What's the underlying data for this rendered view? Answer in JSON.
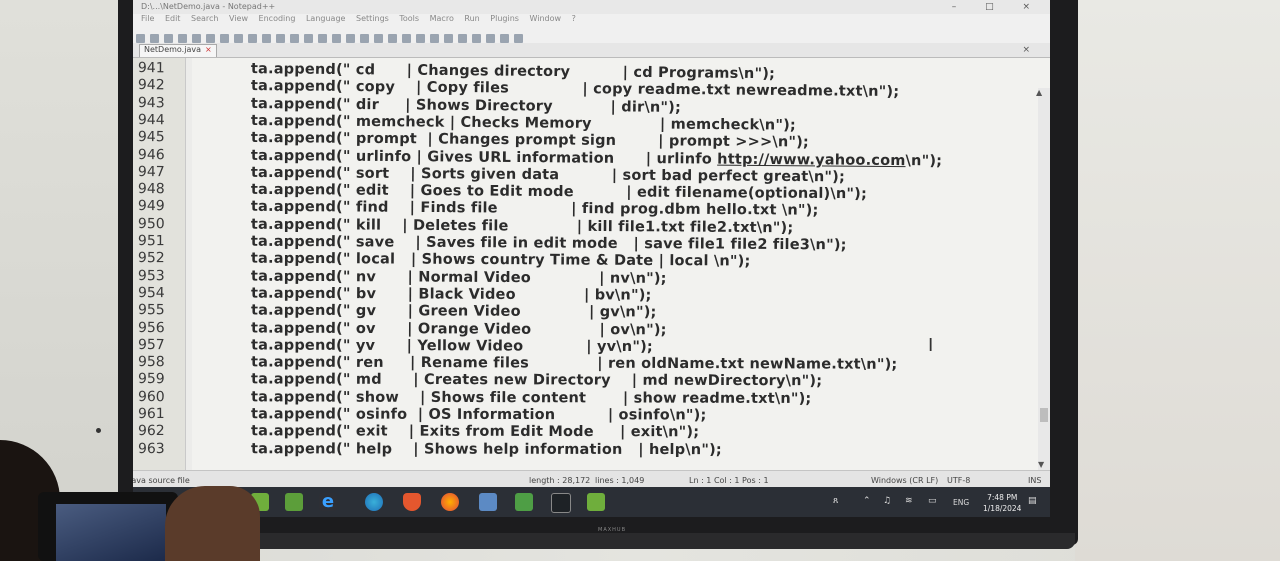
{
  "window": {
    "title": "D:\\...\\NetDemo.java - Notepad++",
    "controls": [
      "–",
      "□",
      "×"
    ]
  },
  "menu": [
    "File",
    "Edit",
    "Search",
    "View",
    "Encoding",
    "Language",
    "Settings",
    "Tools",
    "Macro",
    "Run",
    "Plugins",
    "Window",
    "?"
  ],
  "tab": {
    "label": "NetDemo.java",
    "close": "×"
  },
  "editor": {
    "lines": [
      {
        "num": "941",
        "code": "ta.append(\" cd      | Changes directory          | cd Programs\\n\");"
      },
      {
        "num": "942",
        "code": "ta.append(\" copy    | Copy files              | copy readme.txt newreadme.txt\\n\");"
      },
      {
        "num": "943",
        "code": "ta.append(\" dir     | Shows Directory           | dir\\n\");"
      },
      {
        "num": "944",
        "code": "ta.append(\" memcheck | Checks Memory             | memcheck\\n\");"
      },
      {
        "num": "945",
        "code": "ta.append(\" prompt  | Changes prompt sign        | prompt >>>\\n\");"
      },
      {
        "num": "946",
        "code": "ta.append(\" urlinfo | Gives URL information      | urlinfo ",
        "url": "http://www.yahoo.com",
        "tail": "\\n\");"
      },
      {
        "num": "947",
        "code": "ta.append(\" sort    | Sorts given data          | sort bad perfect great\\n\");"
      },
      {
        "num": "948",
        "code": "ta.append(\" edit    | Goes to Edit mode          | edit filename(optional)\\n\");"
      },
      {
        "num": "949",
        "code": "ta.append(\" find    | Finds file              | find prog.dbm hello.txt \\n\");"
      },
      {
        "num": "950",
        "code": "ta.append(\" kill    | Deletes file             | kill file1.txt file2.txt\\n\");"
      },
      {
        "num": "951",
        "code": "ta.append(\" save    | Saves file in edit mode   | save file1 file2 file3\\n\");"
      },
      {
        "num": "952",
        "code": "ta.append(\" local   | Shows country Time & Date | local \\n\");"
      },
      {
        "num": "953",
        "code": "ta.append(\" nv      | Normal Video             | nv\\n\");"
      },
      {
        "num": "954",
        "code": "ta.append(\" bv      | Black Video             | bv\\n\");"
      },
      {
        "num": "955",
        "code": "ta.append(\" gv      | Green Video             | gv\\n\");"
      },
      {
        "num": "956",
        "code": "ta.append(\" ov      | Orange Video             | ov\\n\");"
      },
      {
        "num": "957",
        "code": "ta.append(\" yv      | Yellow Video            | yv\\n\");"
      },
      {
        "num": "958",
        "code": "ta.append(\" ren     | Rename files             | ren oldName.txt newName.txt\\n\");"
      },
      {
        "num": "959",
        "code": "ta.append(\" md      | Creates new Directory    | md newDirectory\\n\");"
      },
      {
        "num": "960",
        "code": "ta.append(\" show    | Shows file content       | show readme.txt\\n\");"
      },
      {
        "num": "961",
        "code": "ta.append(\" osinfo  | OS Information          | osinfo\\n\");"
      },
      {
        "num": "962",
        "code": "ta.append(\" exit    | Exits from Edit Mode     | exit\\n\");"
      },
      {
        "num": "963",
        "code": "ta.append(\" help    | Shows help information   | help\\n\");"
      }
    ]
  },
  "status": {
    "filetype": "Java source file",
    "length": "length : 28,172",
    "lines": "lines : 1,049",
    "pos": "Ln : 1   Col : 1   Pos : 1",
    "eol": "Windows (CR LF)",
    "encoding": "UTF-8",
    "mode": "INS"
  },
  "taskbar": {
    "time": "7:48 PM",
    "date": "1/18/2024",
    "lang": "ENG"
  },
  "monitor_brand": "MAXHUB"
}
